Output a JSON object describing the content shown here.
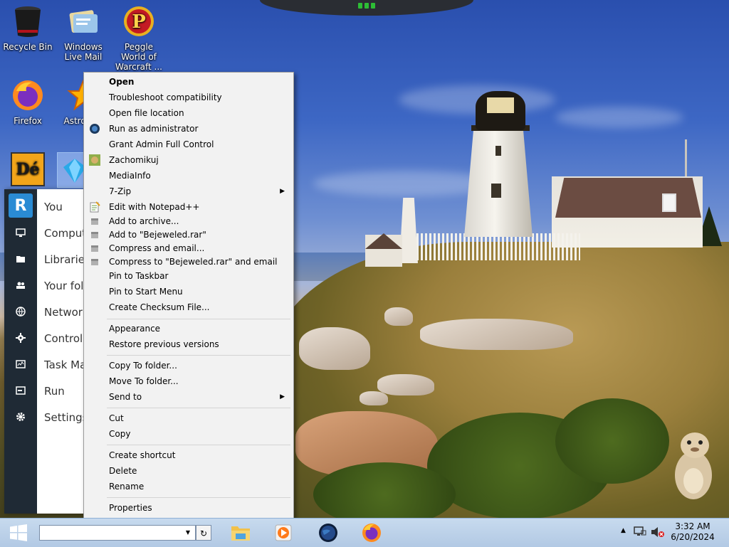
{
  "desktop_icons": [
    {
      "label": "Recycle Bin",
      "icon": "recycle-bin-icon"
    },
    {
      "label": "Windows Live Mail",
      "icon": "mail-icon"
    },
    {
      "label": "Peggle World of Warcraft ...",
      "icon": "peggle-icon"
    },
    {
      "label": "Firefox",
      "icon": "firefox-icon"
    },
    {
      "label": "Astro Del",
      "icon": "star-icon"
    },
    {
      "label": "",
      "icon": "de-icon"
    },
    {
      "label": "",
      "icon": "bejeweled-gem-icon"
    }
  ],
  "start_menu": {
    "logo_letter": "R",
    "items": [
      {
        "label": "You",
        "icon": "user-icon"
      },
      {
        "label": "Comput",
        "icon": "monitor-icon"
      },
      {
        "label": "Libraries",
        "icon": "folder-icon"
      },
      {
        "label": "Your fol",
        "icon": "people-icon"
      },
      {
        "label": "Network",
        "icon": "globe-icon"
      },
      {
        "label": "Control",
        "icon": "control-panel-icon"
      },
      {
        "label": "Task Ma",
        "icon": "task-manager-icon"
      },
      {
        "label": "Run",
        "icon": "run-icon"
      },
      {
        "label": "Settings",
        "icon": "gear-icon"
      }
    ]
  },
  "context_menu": {
    "groups": [
      [
        {
          "label": "Open",
          "bold": true
        },
        {
          "label": "Troubleshoot compatibility"
        },
        {
          "label": "Open file location"
        },
        {
          "label": "Run as administrator",
          "icon": "shield-globe-icon"
        },
        {
          "label": "Grant Admin Full Control"
        },
        {
          "label": "Zachomikuj",
          "icon": "hamster-icon"
        },
        {
          "label": "MediaInfo"
        },
        {
          "label": "7-Zip",
          "submenu": true
        },
        {
          "label": "Edit with Notepad++",
          "icon": "notepad-icon"
        },
        {
          "label": "Add to archive...",
          "icon": "archive-icon"
        },
        {
          "label": "Add to \"Bejeweled.rar\"",
          "icon": "archive-icon"
        },
        {
          "label": "Compress and email...",
          "icon": "archive-icon"
        },
        {
          "label": "Compress to \"Bejeweled.rar\" and email",
          "icon": "archive-icon"
        },
        {
          "label": "Pin to Taskbar"
        },
        {
          "label": "Pin to Start Menu"
        },
        {
          "label": "Create Checksum File..."
        }
      ],
      [
        {
          "label": "Appearance"
        },
        {
          "label": "Restore previous versions"
        }
      ],
      [
        {
          "label": "Copy To folder..."
        },
        {
          "label": "Move To folder..."
        },
        {
          "label": "Send to",
          "submenu": true
        }
      ],
      [
        {
          "label": "Cut"
        },
        {
          "label": "Copy"
        }
      ],
      [
        {
          "label": "Create shortcut"
        },
        {
          "label": "Delete"
        },
        {
          "label": "Rename"
        }
      ],
      [
        {
          "label": "Properties"
        }
      ]
    ]
  },
  "taskbar": {
    "search_value": "",
    "apps": [
      {
        "name": "file-explorer",
        "icon": "folder-icon"
      },
      {
        "name": "media-player",
        "icon": "media-player-icon"
      },
      {
        "name": "globe-app",
        "icon": "globe-icon"
      },
      {
        "name": "firefox",
        "icon": "firefox-icon"
      }
    ],
    "clock": {
      "time": "3:32 AM",
      "date": "6/20/2024"
    }
  },
  "colors": {
    "context_bg": "#f2f2f2",
    "start_rail": "#1f2a35",
    "taskbar": "#b2c9e4",
    "accent": "#2a8bd4"
  }
}
